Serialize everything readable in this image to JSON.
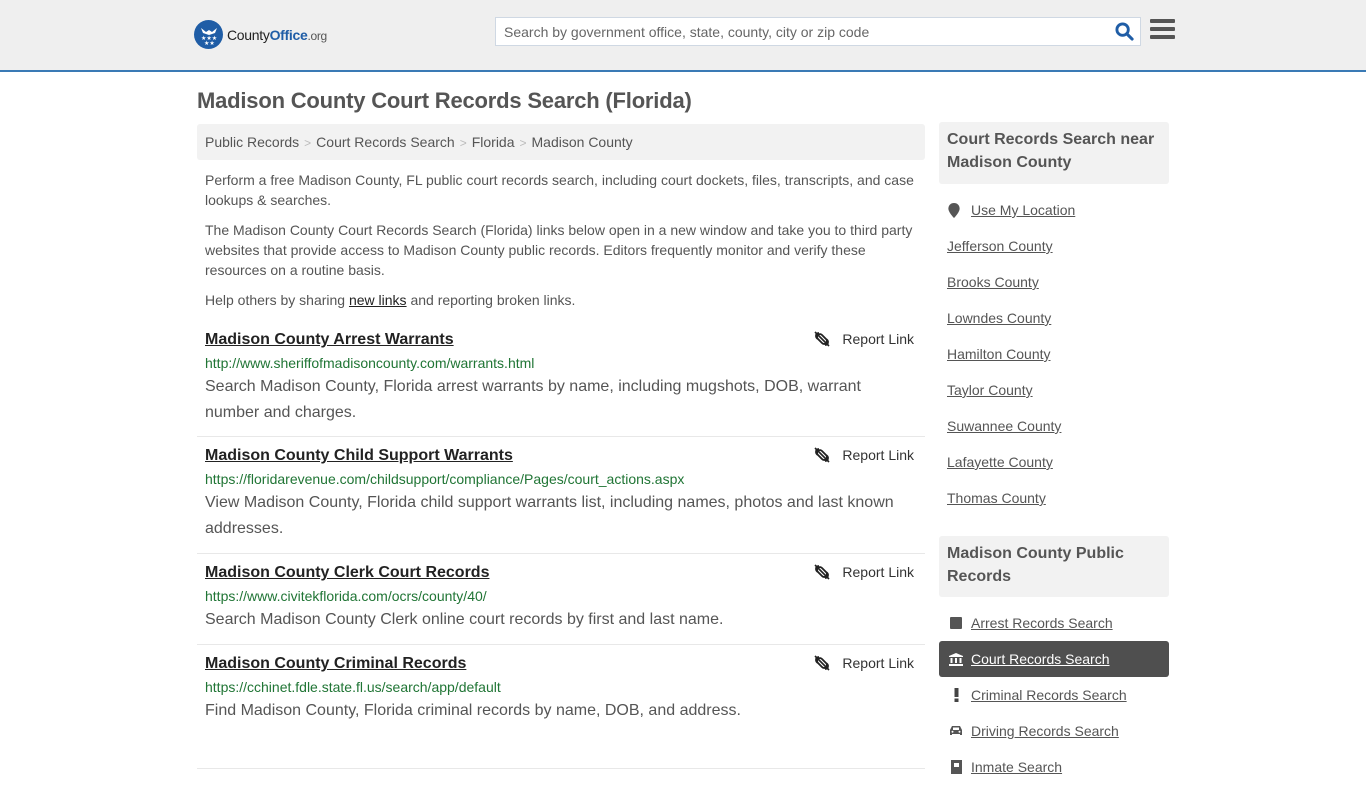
{
  "header": {
    "logo": {
      "part1": "County",
      "part2": "Office",
      "part3": ".org"
    },
    "search_placeholder": "Search by government office, state, county, city or zip code",
    "search_value": ""
  },
  "page": {
    "title": "Madison County Court Records Search (Florida)",
    "breadcrumb": [
      "Public Records",
      "Court Records Search",
      "Florida",
      "Madison County"
    ],
    "intro": {
      "p1": "Perform a free Madison County, FL public court records search, including court dockets, files, transcripts, and case lookups & searches.",
      "p2": "The Madison County Court Records Search (Florida) links below open in a new window and take you to third party websites that provide access to Madison County public records. Editors frequently monitor and verify these resources on a routine basis.",
      "p3_before": "Help others by sharing ",
      "p3_link": "new links",
      "p3_after": " and reporting broken links."
    },
    "report_label": "Report Link",
    "results": [
      {
        "title": "Madison County Arrest Warrants",
        "url": "http://www.sheriffofmadisoncounty.com/warrants.html",
        "desc": "Search Madison County, Florida arrest warrants by name, including mugshots, DOB, warrant number and charges."
      },
      {
        "title": "Madison County Child Support Warrants",
        "url": "https://floridarevenue.com/childsupport/compliance/Pages/court_actions.aspx",
        "desc": "View Madison County, Florida child support warrants list, including names, photos and last known addresses."
      },
      {
        "title": "Madison County Clerk Court Records",
        "url": "https://www.civitekflorida.com/ocrs/county/40/",
        "desc": "Search Madison County Clerk online court records by first and last name."
      },
      {
        "title": "Madison County Criminal Records",
        "url": "https://cchinet.fdle.state.fl.us/search/app/default",
        "desc": "Find Madison County, Florida criminal records by name, DOB, and address."
      }
    ]
  },
  "sidebar": {
    "nearby": {
      "heading": "Court Records Search near Madison County",
      "use_location": "Use My Location",
      "counties": [
        "Jefferson County",
        "Brooks County",
        "Lowndes County",
        "Hamilton County",
        "Taylor County",
        "Suwannee County",
        "Lafayette County",
        "Thomas County"
      ]
    },
    "public_records": {
      "heading": "Madison County Public Records",
      "items": [
        {
          "label": "Arrest Records Search",
          "icon": "square-icon",
          "active": false
        },
        {
          "label": "Court Records Search",
          "icon": "courthouse-icon",
          "active": true
        },
        {
          "label": "Criminal Records Search",
          "icon": "exclamation-icon",
          "active": false
        },
        {
          "label": "Driving Records Search",
          "icon": "car-icon",
          "active": false
        },
        {
          "label": "Inmate Search",
          "icon": "inmate-icon",
          "active": false
        }
      ]
    }
  },
  "colors": {
    "accent": "#1f5da6",
    "header_border": "#3a7ab5",
    "url_green": "#207535",
    "active_bg": "#4f4f4f"
  }
}
